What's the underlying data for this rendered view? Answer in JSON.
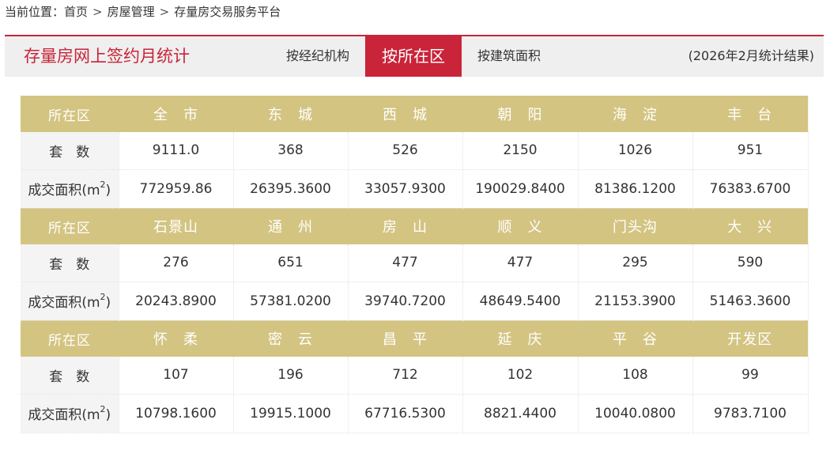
{
  "breadcrumb": {
    "prefix": "当前位置：",
    "items": [
      "首页",
      "房屋管理",
      "存量房交易服务平台"
    ],
    "separator": ">"
  },
  "header": {
    "title": "存量房网上签约月统计",
    "tabs": [
      {
        "label": "按经纪机构",
        "active": false
      },
      {
        "label": "按所在区",
        "active": true
      },
      {
        "label": "按建筑面积",
        "active": false
      }
    ],
    "period_note": "(2026年2月统计结果)"
  },
  "labels": {
    "district": "所在区",
    "count": "套　数",
    "area_base": "成交面积(m",
    "area_sup": "2",
    "area_end": ")"
  },
  "groups": [
    {
      "districts": [
        "全　市",
        "东　城",
        "西　城",
        "朝　阳",
        "海　淀",
        "丰　台"
      ],
      "counts": [
        "9111.0",
        "368",
        "526",
        "2150",
        "1026",
        "951"
      ],
      "areas": [
        "772959.86",
        "26395.3600",
        "33057.9300",
        "190029.8400",
        "81386.1200",
        "76383.6700"
      ]
    },
    {
      "districts": [
        "石景山",
        "通　州",
        "房　山",
        "顺　义",
        "门头沟",
        "大　兴"
      ],
      "counts": [
        "276",
        "651",
        "477",
        "477",
        "295",
        "590"
      ],
      "areas": [
        "20243.8900",
        "57381.0200",
        "39740.7200",
        "48649.5400",
        "21153.3900",
        "51463.3600"
      ]
    },
    {
      "districts": [
        "怀　柔",
        "密　云",
        "昌　平",
        "延　庆",
        "平　谷",
        "开发区"
      ],
      "counts": [
        "107",
        "196",
        "712",
        "102",
        "108",
        "99"
      ],
      "areas": [
        "10798.1600",
        "19915.1000",
        "67716.5300",
        "8821.4400",
        "10040.0800",
        "9783.7100"
      ]
    }
  ],
  "colors": {
    "accent": "#c9243a",
    "header_row": "#d4c482",
    "label_cell": "#f4f4f4",
    "header_bar": "#efefef"
  }
}
